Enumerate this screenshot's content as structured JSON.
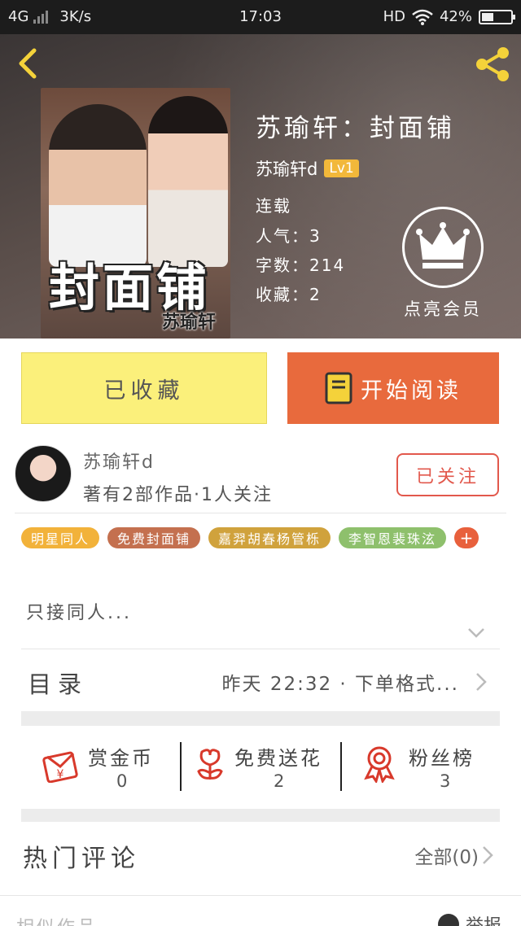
{
  "status_bar": {
    "network": "4G",
    "speed": "3K/s",
    "time": "17:03",
    "hd": "HD",
    "battery": "42%",
    "battery_level": 0.42
  },
  "book": {
    "cover_title": "封面铺",
    "cover_author": "苏瑜轩",
    "title": "苏瑜轩：封面铺",
    "author": "苏瑜轩d",
    "level": "Lv1",
    "status": "连载",
    "popularity": "人气：3",
    "word_count": "字数：214",
    "favorites": "收藏：2",
    "vip_label": "点亮会员"
  },
  "actions": {
    "collect_label": "已收藏",
    "read_label": "开始阅读"
  },
  "author": {
    "name": "苏瑜轩d",
    "stats": "著有2部作品·1人关注",
    "follow_label": "已关注"
  },
  "tags": [
    {
      "label": "明星同人",
      "color": "#f2b23a"
    },
    {
      "label": "免费封面铺",
      "color": "#c4704f"
    },
    {
      "label": "嘉羿胡春杨管栎",
      "color": "#d0a23c"
    },
    {
      "label": "李智恩裴珠泫",
      "color": "#8ec06c"
    }
  ],
  "tag_more": "+",
  "description": "只接同人...",
  "toc": {
    "label": "目录",
    "info": "昨天 22:32 · 下单格式..."
  },
  "stats": [
    {
      "label": "赏金币",
      "value": "0",
      "icon": "red-envelope-icon"
    },
    {
      "label": "免费送花",
      "value": "2",
      "icon": "flower-icon"
    },
    {
      "label": "粉丝榜",
      "value": "3",
      "icon": "medal-icon"
    }
  ],
  "comments": {
    "title": "热门评论",
    "all_label": "全部(0)"
  },
  "footer": {
    "similar": "相似作品",
    "report": "举报"
  },
  "colors": {
    "accent_orange": "#e86a3d",
    "collect_yellow": "#fbf07b",
    "follow_red": "#e2584c",
    "icon_red": "#d8392b"
  }
}
